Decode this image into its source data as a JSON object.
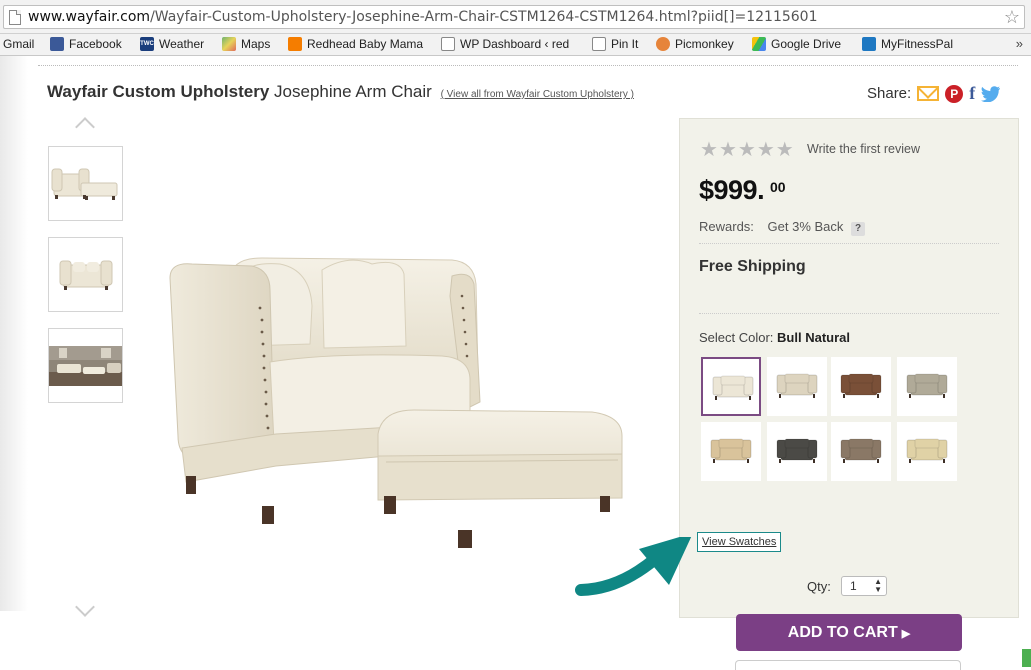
{
  "browser": {
    "url_host": "www.wayfair.com",
    "url_path": "/Wayfair-Custom-Upholstery-Josephine-Arm-Chair-CSTM1264-CSTM1264.html?piid[]=12115601",
    "bookmarks": [
      "Gmail",
      "Facebook",
      "Weather",
      "Maps",
      "Redhead Baby Mama",
      "WP Dashboard ‹ red",
      "Pin It",
      "Picmonkey",
      "Google Drive",
      "MyFitnessPal"
    ],
    "more": "»",
    "weather_badge": "TWC"
  },
  "product": {
    "brand": "Wayfair Custom Upholstery",
    "name": "Josephine Arm Chair",
    "view_all": "( View all from Wayfair Custom Upholstery )"
  },
  "share": {
    "label": "Share:",
    "pin_glyph": "P",
    "fb_glyph": "f"
  },
  "rating": {
    "stars": 0,
    "max": 5,
    "review_link": "Write the first review"
  },
  "price": {
    "dollars": "$999.",
    "cents": "00"
  },
  "rewards": {
    "label": "Rewards:",
    "value": "Get 3% Back",
    "help": "?"
  },
  "shipping": "Free Shipping",
  "color": {
    "label": "Select Color:",
    "selected": "Bull Natural"
  },
  "swatches": [
    {
      "color": "#ece6d6",
      "selected": true
    },
    {
      "color": "#ddd4bf",
      "selected": false
    },
    {
      "color": "#7a5038",
      "selected": false
    },
    {
      "color": "#b0aa98",
      "selected": false
    },
    {
      "color": "#d9c39b",
      "selected": false
    },
    {
      "color": "#4b4a46",
      "selected": false
    },
    {
      "color": "#8a7866",
      "selected": false
    },
    {
      "color": "#e0d2a6",
      "selected": false
    }
  ],
  "view_swatches": "View Swatches",
  "qty": {
    "label": "Qty:",
    "value": "1"
  },
  "cart_button": "ADD TO CART",
  "colors": {
    "accent": "#7b3f85",
    "annotation": "#0f8784"
  }
}
